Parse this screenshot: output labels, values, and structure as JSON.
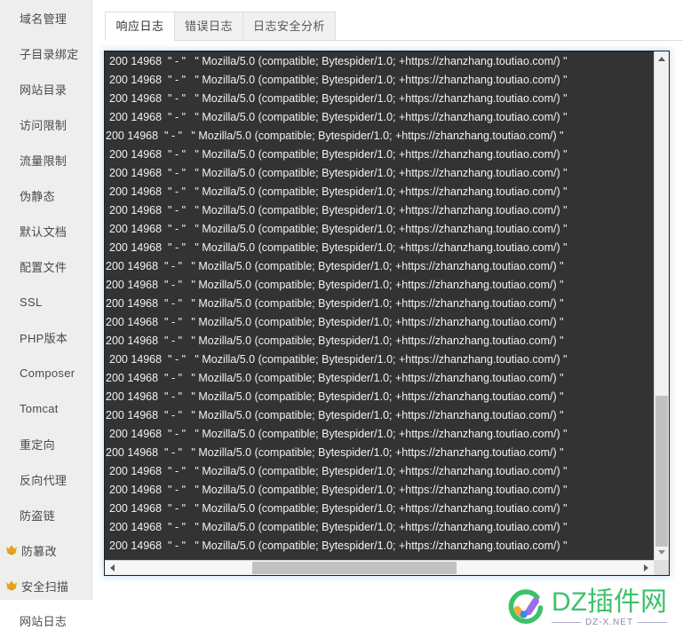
{
  "sidebar": {
    "items": [
      {
        "label": "域名管理",
        "icon": null
      },
      {
        "label": "子目录绑定",
        "icon": null
      },
      {
        "label": "网站目录",
        "icon": null
      },
      {
        "label": "访问限制",
        "icon": null
      },
      {
        "label": "流量限制",
        "icon": null
      },
      {
        "label": "伪静态",
        "icon": null
      },
      {
        "label": "默认文档",
        "icon": null
      },
      {
        "label": "配置文件",
        "icon": null
      },
      {
        "label": "SSL",
        "icon": null
      },
      {
        "label": "PHP版本",
        "icon": null
      },
      {
        "label": "Composer",
        "icon": null
      },
      {
        "label": "Tomcat",
        "icon": null
      },
      {
        "label": "重定向",
        "icon": null
      },
      {
        "label": "反向代理",
        "icon": null
      },
      {
        "label": "防盗链",
        "icon": null
      },
      {
        "label": "防篡改",
        "icon": "crown-icon"
      },
      {
        "label": "安全扫描",
        "icon": "crown-icon"
      },
      {
        "label": "网站日志",
        "icon": null
      }
    ],
    "icon_color": "#e8a317"
  },
  "tabs": [
    {
      "label": "响应日志",
      "active": true
    },
    {
      "label": "错误日志",
      "active": false
    },
    {
      "label": "日志安全分析",
      "active": false
    }
  ],
  "log_panel": {
    "background": "#333333",
    "text_color": "#f2f2f2",
    "lines": [
      "200 14968  \" - \"   \" Mozilla/5.0 (compatible; Bytespider/1.0; +https://zhanzhang.toutiao.com/) \"",
      "200 14968  \" - \"   \" Mozilla/5.0 (compatible; Bytespider/1.0; +https://zhanzhang.toutiao.com/) \"",
      "200 14968  \" - \"   \" Mozilla/5.0 (compatible; Bytespider/1.0; +https://zhanzhang.toutiao.com/) \"",
      "200 14968  \" - \"   \" Mozilla/5.0 (compatible; Bytespider/1.0; +https://zhanzhang.toutiao.com/) \"",
      "200 14968  \" - \"   \" Mozilla/5.0 (compatible; Bytespider/1.0; +https://zhanzhang.toutiao.com/) \"",
      "200 14968  \" - \"   \" Mozilla/5.0 (compatible; Bytespider/1.0; +https://zhanzhang.toutiao.com/) \"",
      "200 14968  \" - \"   \" Mozilla/5.0 (compatible; Bytespider/1.0; +https://zhanzhang.toutiao.com/) \"",
      "200 14968  \" - \"   \" Mozilla/5.0 (compatible; Bytespider/1.0; +https://zhanzhang.toutiao.com/) \"",
      "200 14968  \" - \"   \" Mozilla/5.0 (compatible; Bytespider/1.0; +https://zhanzhang.toutiao.com/) \"",
      "200 14968  \" - \"   \" Mozilla/5.0 (compatible; Bytespider/1.0; +https://zhanzhang.toutiao.com/) \"",
      "200 14968  \" - \"   \" Mozilla/5.0 (compatible; Bytespider/1.0; +https://zhanzhang.toutiao.com/) \"",
      "200 14968  \" - \"   \" Mozilla/5.0 (compatible; Bytespider/1.0; +https://zhanzhang.toutiao.com/) \"",
      "200 14968  \" - \"   \" Mozilla/5.0 (compatible; Bytespider/1.0; +https://zhanzhang.toutiao.com/) \"",
      "200 14968  \" - \"   \" Mozilla/5.0 (compatible; Bytespider/1.0; +https://zhanzhang.toutiao.com/) \"",
      "200 14968  \" - \"   \" Mozilla/5.0 (compatible; Bytespider/1.0; +https://zhanzhang.toutiao.com/) \"",
      "200 14968  \" - \"   \" Mozilla/5.0 (compatible; Bytespider/1.0; +https://zhanzhang.toutiao.com/) \"",
      "200 14968  \" - \"   \" Mozilla/5.0 (compatible; Bytespider/1.0; +https://zhanzhang.toutiao.com/) \"",
      "200 14968  \" - \"   \" Mozilla/5.0 (compatible; Bytespider/1.0; +https://zhanzhang.toutiao.com/) \"",
      "200 14968  \" - \"   \" Mozilla/5.0 (compatible; Bytespider/1.0; +https://zhanzhang.toutiao.com/) \"",
      "200 14968  \" - \"   \" Mozilla/5.0 (compatible; Bytespider/1.0; +https://zhanzhang.toutiao.com/) \"",
      "200 14968  \" - \"   \" Mozilla/5.0 (compatible; Bytespider/1.0; +https://zhanzhang.toutiao.com/) \"",
      "200 14968  \" - \"   \" Mozilla/5.0 (compatible; Bytespider/1.0; +https://zhanzhang.toutiao.com/) \"",
      "200 14968  \" - \"   \" Mozilla/5.0 (compatible; Bytespider/1.0; +https://zhanzhang.toutiao.com/) \"",
      "200 14968  \" - \"   \" Mozilla/5.0 (compatible; Bytespider/1.0; +https://zhanzhang.toutiao.com/) \"",
      "200 14968  \" - \"   \" Mozilla/5.0 (compatible; Bytespider/1.0; +https://zhanzhang.toutiao.com/) \"",
      "200 14968  \" - \"   \" Mozilla/5.0 (compatible; Bytespider/1.0; +https://zhanzhang.toutiao.com/) \"",
      "200 14968  \" - \"   \" Mozilla/5.0 (compatible; Bytespider/1.0; +https://zhanzhang.toutiao.com/) \""
    ]
  },
  "watermark": {
    "title": "DZ插件网",
    "subtitle": "DZ-X.NET",
    "brand_color": "#3cc26a"
  }
}
